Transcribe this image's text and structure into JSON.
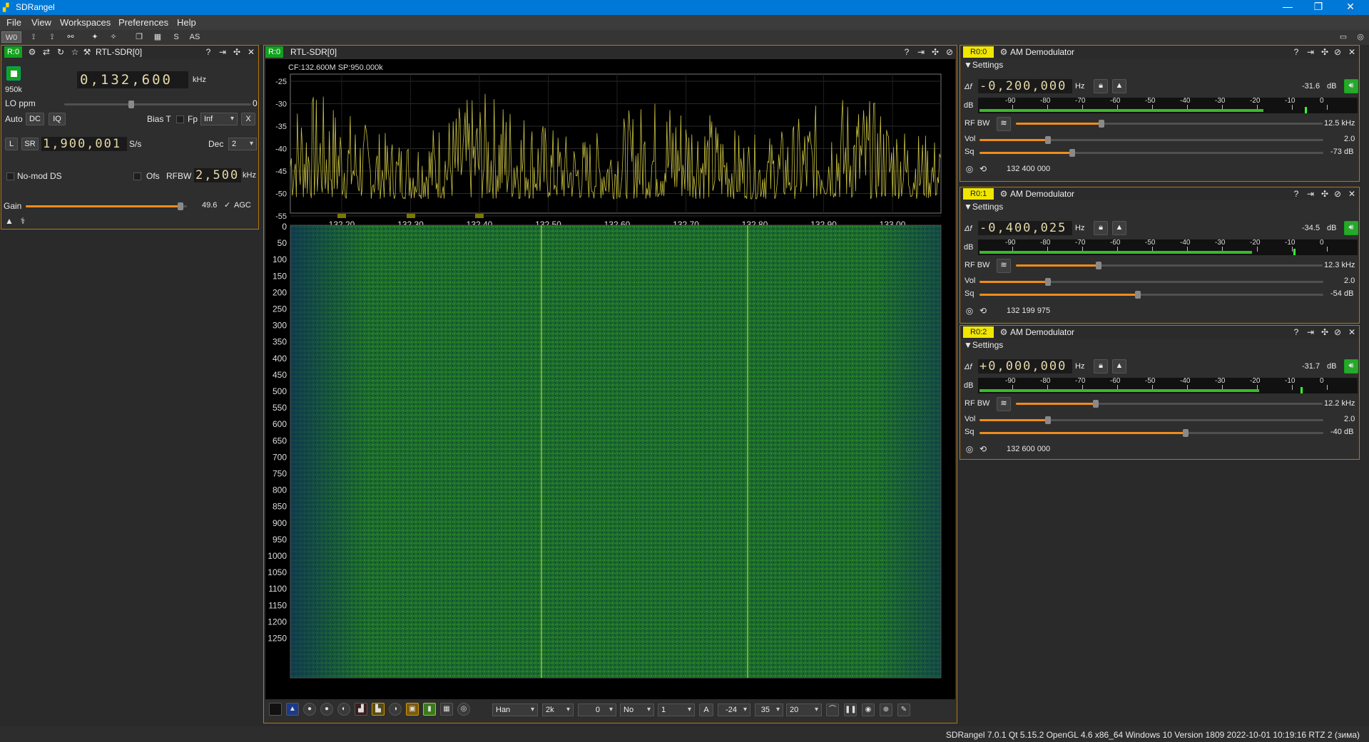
{
  "window": {
    "title": "SDRangel",
    "minimize": "—",
    "restore": "❐",
    "close": "✕"
  },
  "menu": [
    "File",
    "View",
    "Workspaces",
    "Preferences",
    "Help"
  ],
  "toolbar": {
    "workspace": "W0",
    "s_label": "S",
    "as_label": "AS"
  },
  "device": {
    "tag": "R:0",
    "title": "RTL-SDR[0]",
    "sample_rate_label": "950k",
    "center_freq": "0,132,600",
    "freq_unit": "kHz",
    "lo_ppm_label": "LO ppm",
    "lo_ppm_value": "0",
    "auto_label": "Auto",
    "dc_label": "DC",
    "iq_label": "IQ",
    "bias_t_label": "Bias T",
    "fp_label": "Fp",
    "fp_value": "Inf",
    "x_label": "X",
    "l_label": "L",
    "sr_label": "SR",
    "sr_value": "1,900,001",
    "sr_unit": "S/s",
    "dec_label": "Dec",
    "dec_value": "2",
    "nomod_label": "No-mod DS",
    "ofs_label": "Ofs",
    "rfbw_label": "RFBW",
    "rfbw_value": "2,500",
    "rfbw_unit": "kHz",
    "gain_label": "Gain",
    "gain_value": "49.6",
    "gain_fraction": 0.96,
    "agc_label": "AGC",
    "agc_checked": "✓"
  },
  "spectrum": {
    "tag": "R:0",
    "title": "RTL-SDR[0]",
    "info": "CF:132.600M SP:950.000k",
    "db_ticks": [
      "-25",
      "-30",
      "-35",
      "-40",
      "-45",
      "-50",
      "-55"
    ],
    "freq_ticks": [
      "132.20",
      "132.30",
      "132.40",
      "132.50",
      "132.60",
      "132.70",
      "132.80",
      "132.90",
      "133.00"
    ],
    "wf_ticks": [
      "0",
      "50",
      "100",
      "150",
      "200",
      "250",
      "300",
      "350",
      "400",
      "450",
      "500",
      "550",
      "600",
      "650",
      "700",
      "750",
      "800",
      "850",
      "900",
      "950",
      "1000",
      "1050",
      "1100",
      "1150",
      "1200",
      "1250"
    ],
    "controls": {
      "window": "Han",
      "fft_size": "2k",
      "overlap": "0",
      "avg_mode": "No",
      "avg": "1",
      "a_label": "A",
      "ref": "-24",
      "range": "35",
      "fps": "20"
    }
  },
  "channels": [
    {
      "tag": "R0:0",
      "title": "AM Demodulator",
      "settings": "Settings",
      "df": "-0,200,000",
      "df_unit": "Hz",
      "level": "-31.6",
      "level_unit": "dB",
      "db_label": "dB",
      "scale": [
        "-90",
        "-80",
        "-70",
        "-60",
        "-50",
        "-40",
        "-30",
        "-20",
        "-10",
        "0"
      ],
      "rfbw_label": "RF BW",
      "rfbw": "12.5 kHz",
      "rfbw_frac": 0.28,
      "vol_label": "Vol",
      "vol": "2.0",
      "vol_frac": 0.2,
      "sq_label": "Sq",
      "sq": "-73 dB",
      "sq_frac": 0.27,
      "freq": "132 400 000",
      "meter_frac": 0.75
    },
    {
      "tag": "R0:1",
      "title": "AM Demodulator",
      "settings": "Settings",
      "df": "-0,400,025",
      "df_unit": "Hz",
      "level": "-34.5",
      "level_unit": "dB",
      "db_label": "dB",
      "scale": [
        "-90",
        "-80",
        "-70",
        "-60",
        "-50",
        "-40",
        "-30",
        "-20",
        "-10",
        "0"
      ],
      "rfbw_label": "RF BW",
      "rfbw": "12.3 kHz",
      "rfbw_frac": 0.27,
      "vol_label": "Vol",
      "vol": "2.0",
      "vol_frac": 0.2,
      "sq_label": "Sq",
      "sq": "-54 dB",
      "sq_frac": 0.46,
      "freq": "132 199 975",
      "meter_frac": 0.72
    },
    {
      "tag": "R0:2",
      "title": "AM Demodulator",
      "settings": "Settings",
      "df": "+0,000,000",
      "df_unit": "Hz",
      "level": "-31.7",
      "level_unit": "dB",
      "db_label": "dB",
      "scale": [
        "-90",
        "-80",
        "-70",
        "-60",
        "-50",
        "-40",
        "-30",
        "-20",
        "-10",
        "0"
      ],
      "rfbw_label": "RF BW",
      "rfbw": "12.2 kHz",
      "rfbw_frac": 0.26,
      "vol_label": "Vol",
      "vol": "2.0",
      "vol_frac": 0.2,
      "sq_label": "Sq",
      "sq": "-40 dB",
      "sq_frac": 0.6,
      "freq": "132 600 000",
      "meter_frac": 0.74
    }
  ],
  "status": "SDRangel 7.0.1 Qt 5.15.2 OpenGL 4.6 x86_64 Windows 10 Version 1809  2022-10-01 10:19:16 RTZ 2 (зима)"
}
